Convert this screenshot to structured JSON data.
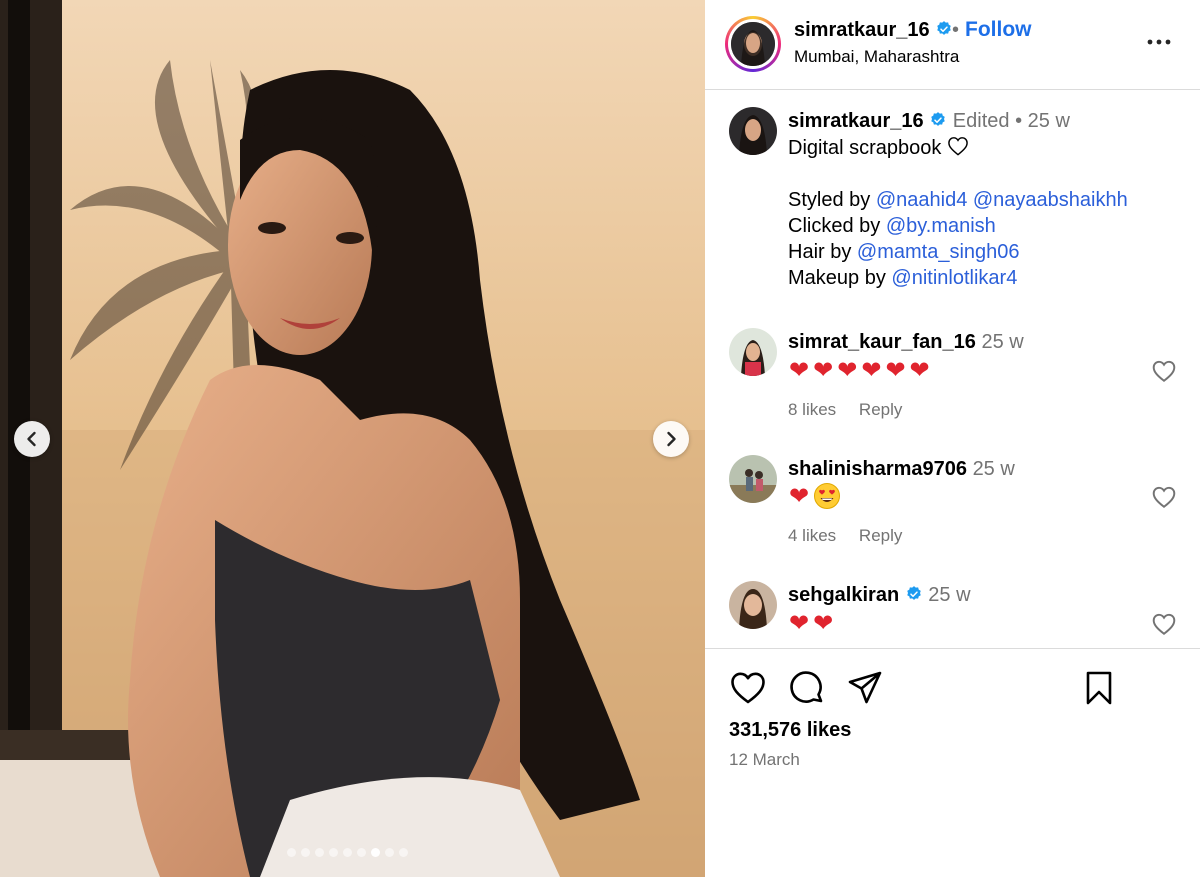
{
  "post": {
    "username": "simratkaur_16",
    "follow_label": "Follow",
    "separator": "•",
    "location": "Mumbai, Maharashtra",
    "carousel": {
      "total_slides": 9,
      "active_slide": 7
    }
  },
  "caption": {
    "username": "simratkaur_16",
    "edited": "Edited",
    "separator": "•",
    "time": "25 w",
    "line1": "Digital scrapbook",
    "styled_prefix": "Styled by",
    "styled_mention1": "@naahid4",
    "styled_mention2": "@nayaabshaikhh",
    "clicked_prefix": "Clicked by",
    "clicked_mention": "@by.manish",
    "hair_prefix": "Hair by",
    "hair_mention": "@mamta_singh06",
    "makeup_prefix": "Makeup by",
    "makeup_mention": "@nitinlotlikar4"
  },
  "comments": [
    {
      "username": "simrat_kaur_fan_16",
      "time": "25 w",
      "emojis": "❤❤❤❤❤❤",
      "likes": "8 likes",
      "reply": "Reply"
    },
    {
      "username": "shalinisharma9706",
      "time": "25 w",
      "emojis": "❤😍",
      "likes": "4 likes",
      "reply": "Reply"
    },
    {
      "username": "sehgalkiran",
      "time": "25 w",
      "emojis": "❤❤",
      "verified": true
    }
  ],
  "footer": {
    "likes": "331,576 likes",
    "date": "12 March"
  },
  "colors": {
    "link": "#2b5fd9",
    "follow": "#1d6fe8",
    "verified": "#1d9bf0",
    "meta": "#737373"
  },
  "icons": [
    "verified-badge-icon",
    "more-options-icon",
    "chevron-left-icon",
    "chevron-right-icon",
    "heart-outline-icon",
    "comment-icon",
    "share-icon",
    "bookmark-icon"
  ]
}
